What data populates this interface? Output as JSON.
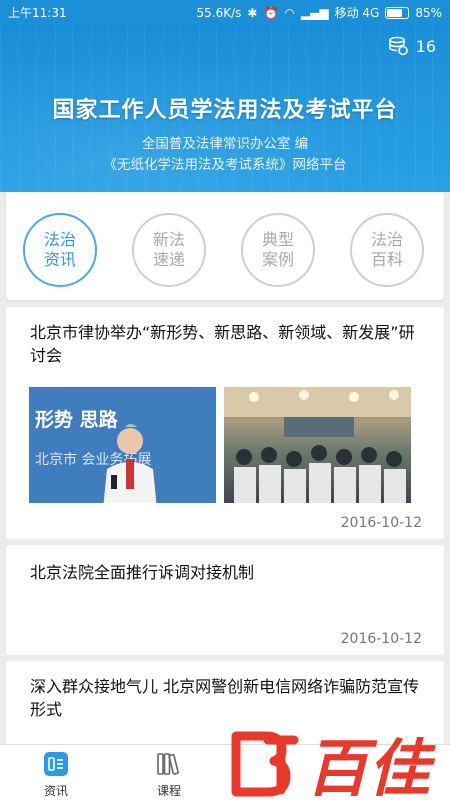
{
  "status_bar": {
    "time": "上午11:31",
    "speed": "55.6K/s",
    "network": "移动 4G",
    "battery": "85%",
    "battery_level": 0.85
  },
  "header": {
    "points": "16",
    "title": "国家工作人员学法用法及考试平台",
    "subtitle1": "全国普及法律常识办公室 编",
    "subtitle2": "《无纸化学法用法及考试系统》网络平台"
  },
  "categories": [
    {
      "line1": "法治",
      "line2": "资讯",
      "active": true
    },
    {
      "line1": "新法",
      "line2": "速递",
      "active": false
    },
    {
      "line1": "典型",
      "line2": "案例",
      "active": false
    },
    {
      "line1": "法治",
      "line2": "百科",
      "active": false
    }
  ],
  "articles": [
    {
      "title": "北京市律协举办“新形势、新思路、新领域、新发展”研讨会",
      "date": "2016-10-12",
      "photo_text1": "形势  思路",
      "photo_text2": "北京市      会业务拓展"
    },
    {
      "title": "北京法院全面推行诉调对接机制",
      "date": "2016-10-12"
    },
    {
      "title": "深入群众接地气儿 北京网警创新电信网络诈骗防范宣传形式"
    }
  ],
  "bottom_nav": [
    {
      "label": "资讯",
      "icon": "news-icon"
    },
    {
      "label": "课程",
      "icon": "books-icon"
    }
  ],
  "watermark": "百佳",
  "colors": {
    "primary": "#1b8fd8",
    "active": "#2b9ae3",
    "watermark": "#e8392b"
  }
}
